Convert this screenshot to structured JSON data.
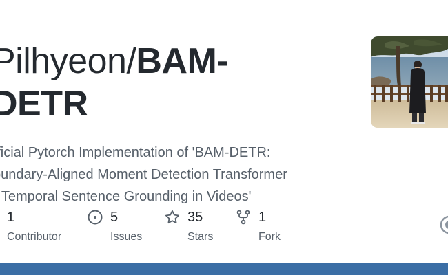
{
  "repo": {
    "owner_prefix": "Pilhyeon/",
    "name_line1": "BAM-",
    "name_line2": "DETR",
    "description": "fficial Pytorch Implementation of 'BAM-DETR: oundary-Aligned Moment Detection Transformer r Temporal Sentence Grounding in Videos'",
    "description_lines": [
      "fficial Pytorch Implementation of 'BAM-DETR:",
      "oundary-Aligned Moment Detection Transformer",
      "r Temporal Sentence Grounding in Videos'"
    ]
  },
  "stats": {
    "contributors": {
      "value": "1",
      "label": "Contributor",
      "icon": "people-icon"
    },
    "issues": {
      "value": "5",
      "label": "Issues",
      "icon": "issue-opened-icon"
    },
    "stars": {
      "value": "35",
      "label": "Stars",
      "icon": "star-icon"
    },
    "forks": {
      "value": "1",
      "label": "Fork",
      "icon": "repo-forked-icon"
    }
  },
  "colors": {
    "title": "#24292f",
    "muted": "#57606a",
    "bottom_bar": "#3b6ea5"
  },
  "avatar": {
    "icon": "owner-avatar-photo"
  },
  "brand": {
    "icon": "github-mark-icon"
  }
}
